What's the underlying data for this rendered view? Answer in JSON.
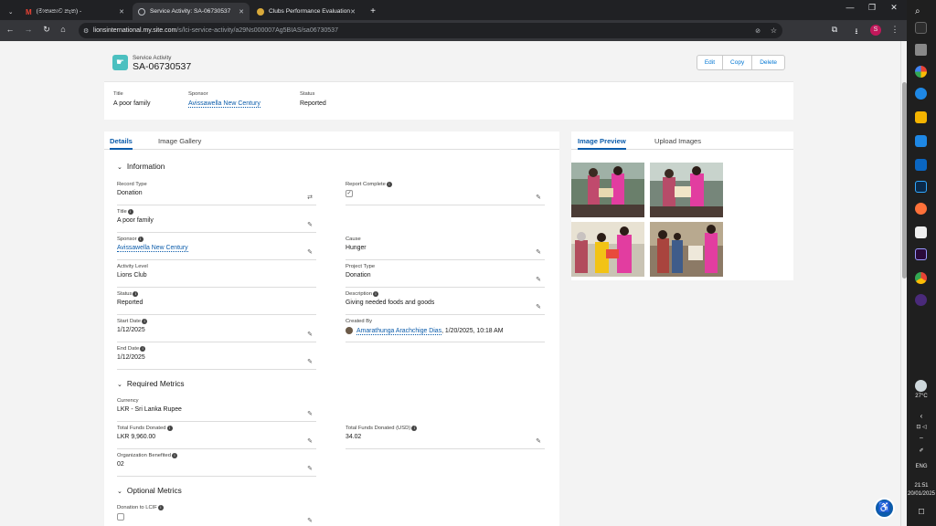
{
  "browser": {
    "tabs": [
      {
        "label": "(මාතෘකාව නැත) - ",
        "icon": "gmail-icon"
      },
      {
        "label": "Service Activity: SA-06730537",
        "icon": "service-activity-icon"
      },
      {
        "label": "Clubs Performance Evaluation",
        "icon": "lions-icon"
      }
    ],
    "url_host": "lionsinternational.my.site.com",
    "url_path": "/s/lci-service-activity/a29Ns000007Ag5BIAS/sa06730537"
  },
  "record": {
    "object_label": "Service Activity",
    "name": "SA-06730537",
    "buttons": [
      "Edit",
      "Copy",
      "Delete"
    ]
  },
  "highlights": {
    "title_label": "Title",
    "title_value": "A poor family",
    "sponsor_label": "Sponsor",
    "sponsor_value": "Avissawella New Century",
    "status_label": "Status",
    "status_value": "Reported"
  },
  "left_tabs": [
    "Details",
    "Image Gallery"
  ],
  "right_tabs": [
    "Image Preview",
    "Upload Images"
  ],
  "sections": {
    "information": "Information",
    "required": "Required Metrics",
    "optional": "Optional Metrics"
  },
  "fields": {
    "record_type": {
      "label": "Record Type",
      "value": "Donation"
    },
    "report_complete": {
      "label": "Report Complete",
      "value": "✓"
    },
    "title": {
      "label": "Title",
      "value": "A poor family"
    },
    "sponsor": {
      "label": "Sponsor",
      "value": "Avissawella New Century"
    },
    "cause": {
      "label": "Cause",
      "value": "Hunger"
    },
    "activity_level": {
      "label": "Activity Level",
      "value": "Lions Club"
    },
    "project_type": {
      "label": "Project Type",
      "value": "Donation"
    },
    "status": {
      "label": "Status",
      "value": "Reported"
    },
    "description": {
      "label": "Description",
      "value": "Giving needed foods and goods"
    },
    "start_date": {
      "label": "Start Date",
      "value": "1/12/2025"
    },
    "created_by": {
      "label": "Created By",
      "name": "Amarathunga Arachchige Dias",
      "date": ", 1/20/2025, 10:18 AM"
    },
    "end_date": {
      "label": "End Date",
      "value": "1/12/2025"
    },
    "currency": {
      "label": "Currency",
      "value": "LKR - Sri Lanka Rupee"
    },
    "total_funds": {
      "label": "Total Funds Donated",
      "value": "LKR 9,960.00"
    },
    "total_funds_usd": {
      "label": "Total Funds Donated (USD)",
      "value": "34.02"
    },
    "org_benefited": {
      "label": "Organization Benefited",
      "value": "02"
    },
    "donation_lcif": {
      "label": "Donation to LCIF",
      "value": ""
    }
  },
  "taskbar": {
    "weather": "27°C",
    "language": "ENG",
    "time": "21:51",
    "date": "20/01/2025"
  }
}
